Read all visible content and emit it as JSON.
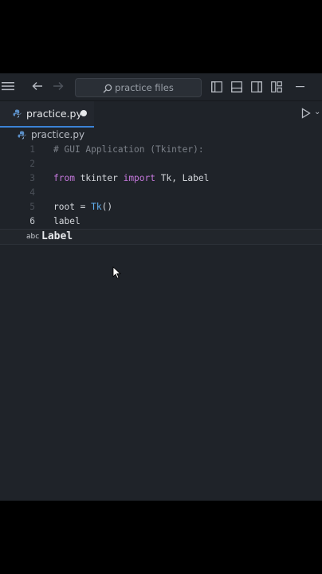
{
  "titlebar": {
    "search_placeholder": "practice files"
  },
  "tabs": [
    {
      "label": "practice.py",
      "modified": true
    }
  ],
  "breadcrumb": {
    "file": "practice.py"
  },
  "editor": {
    "active_line": 6,
    "lines": [
      {
        "number": "1",
        "text": "# GUI Application (Tkinter):"
      },
      {
        "number": "2",
        "text": ""
      },
      {
        "number": "3",
        "text_parts": [
          "from",
          " tkinter ",
          "import",
          " Tk, Label"
        ]
      },
      {
        "number": "4",
        "text": ""
      },
      {
        "number": "5",
        "text_parts": [
          "root = ",
          "Tk",
          "()"
        ]
      },
      {
        "number": "6",
        "text": "label"
      }
    ]
  },
  "autocomplete": {
    "kind": "abc",
    "suggestion": "Label"
  },
  "colors": {
    "background": "#1f2329",
    "accent": "#3b82d6",
    "keyword": "#c678dd",
    "function": "#61afef",
    "comment": "#7b8088"
  }
}
